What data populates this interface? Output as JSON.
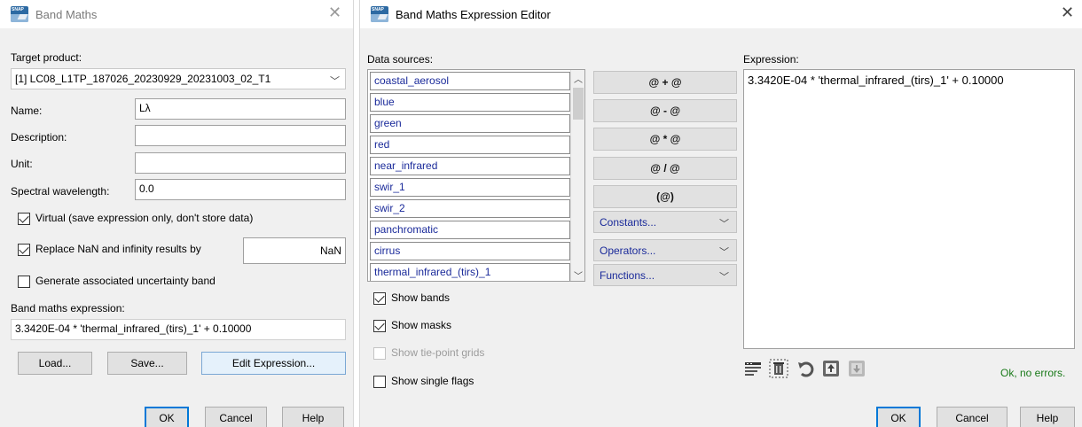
{
  "left_dialog": {
    "title": "Band Maths",
    "target_product_label": "Target product:",
    "target_product_value": "[1] LC08_L1TP_187026_20230929_20231003_02_T1",
    "name_label": "Name:",
    "name_value": "Lλ",
    "description_label": "Description:",
    "description_value": "",
    "unit_label": "Unit:",
    "unit_value": "",
    "spectral_label": "Spectral wavelength:",
    "spectral_value": "0.0",
    "virtual_label": "Virtual (save expression only, don't store data)",
    "replace_nan_label": "Replace NaN and infinity results by",
    "replace_nan_value": "NaN",
    "uncertainty_label": "Generate associated uncertainty band",
    "expression_label": "Band maths expression:",
    "expression_value": "3.3420E-04 * 'thermal_infrared_(tirs)_1' + 0.10000",
    "load_label": "Load...",
    "save_label": "Save...",
    "edit_label": "Edit Expression...",
    "ok_label": "OK",
    "cancel_label": "Cancel",
    "help_label": "Help"
  },
  "right_dialog": {
    "title": "Band Maths Expression Editor",
    "data_sources_label": "Data sources:",
    "bands": [
      "coastal_aerosol",
      "blue",
      "green",
      "red",
      "near_infrared",
      "swir_1",
      "swir_2",
      "panchromatic",
      "cirrus",
      "thermal_infrared_(tirs)_1"
    ],
    "operators": [
      "@ + @",
      "@ - @",
      "@ * @",
      "@ / @",
      "(@)"
    ],
    "constants_label": "Constants...",
    "operators_label": "Operators...",
    "functions_label": "Functions...",
    "show_bands_label": "Show bands",
    "show_masks_label": "Show masks",
    "show_tiepoint_label": "Show tie-point grids",
    "show_single_flags_label": "Show single flags",
    "expression_label": "Expression:",
    "expression_value": "3.3420E-04 * 'thermal_infrared_(tirs)_1' + 0.10000",
    "status_text": "Ok, no errors.",
    "ok_label": "OK",
    "cancel_label": "Cancel",
    "help_label": "Help"
  },
  "colors": {
    "status_ok": "#1a7a1a",
    "list_text": "#1a2a9a",
    "dialog_bg": "#f0f0f0"
  }
}
